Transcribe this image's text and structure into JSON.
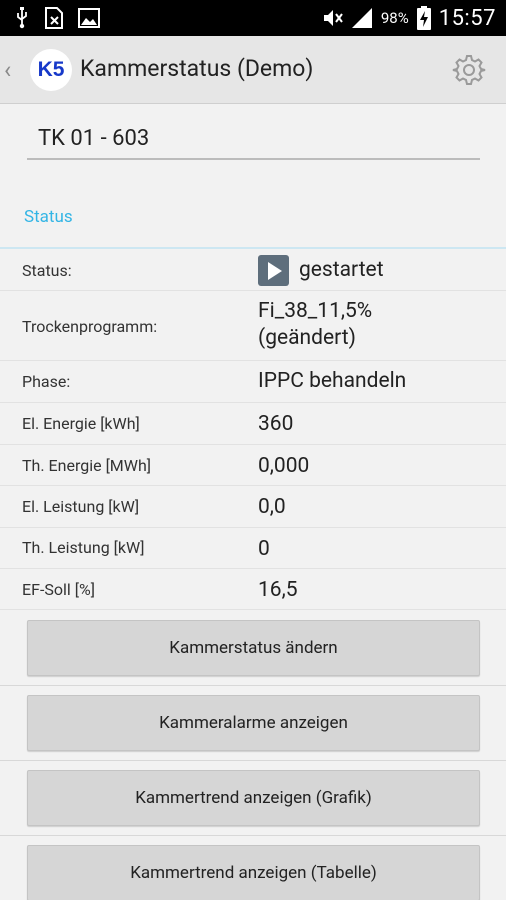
{
  "statusbar": {
    "battery": "98%",
    "time": "15:57"
  },
  "actionbar": {
    "back_glyph": "‹",
    "logo": "K5",
    "title": "Kammerstatus (Demo)"
  },
  "chamber": {
    "value": "TK 01 - 603"
  },
  "section": {
    "title": "Status"
  },
  "rows": [
    {
      "label": "Status:",
      "value": "gestartet"
    },
    {
      "label": "Trockenprogramm:",
      "value": "Fi_38_11,5%",
      "value2": "(geändert)"
    },
    {
      "label": "Phase:",
      "value": "IPPC behandeln"
    },
    {
      "label": "El. Energie [kWh]",
      "value": "360"
    },
    {
      "label": "Th. Energie [MWh]",
      "value": "0,000"
    },
    {
      "label": "El. Leistung [kW]",
      "value": "0,0"
    },
    {
      "label": "Th. Leistung [kW]",
      "value": "0"
    },
    {
      "label": "EF-Soll [%]",
      "value": "16,5"
    }
  ],
  "buttons": [
    {
      "label": "Kammerstatus ändern"
    },
    {
      "label": "Kammeralarme anzeigen"
    },
    {
      "label": "Kammertrend anzeigen (Grafik)"
    },
    {
      "label": "Kammertrend anzeigen (Tabelle)"
    }
  ],
  "colors": {
    "accent": "#33b5e5",
    "logo_text": "#1739c9",
    "play_icon": "#5e6e7c"
  }
}
